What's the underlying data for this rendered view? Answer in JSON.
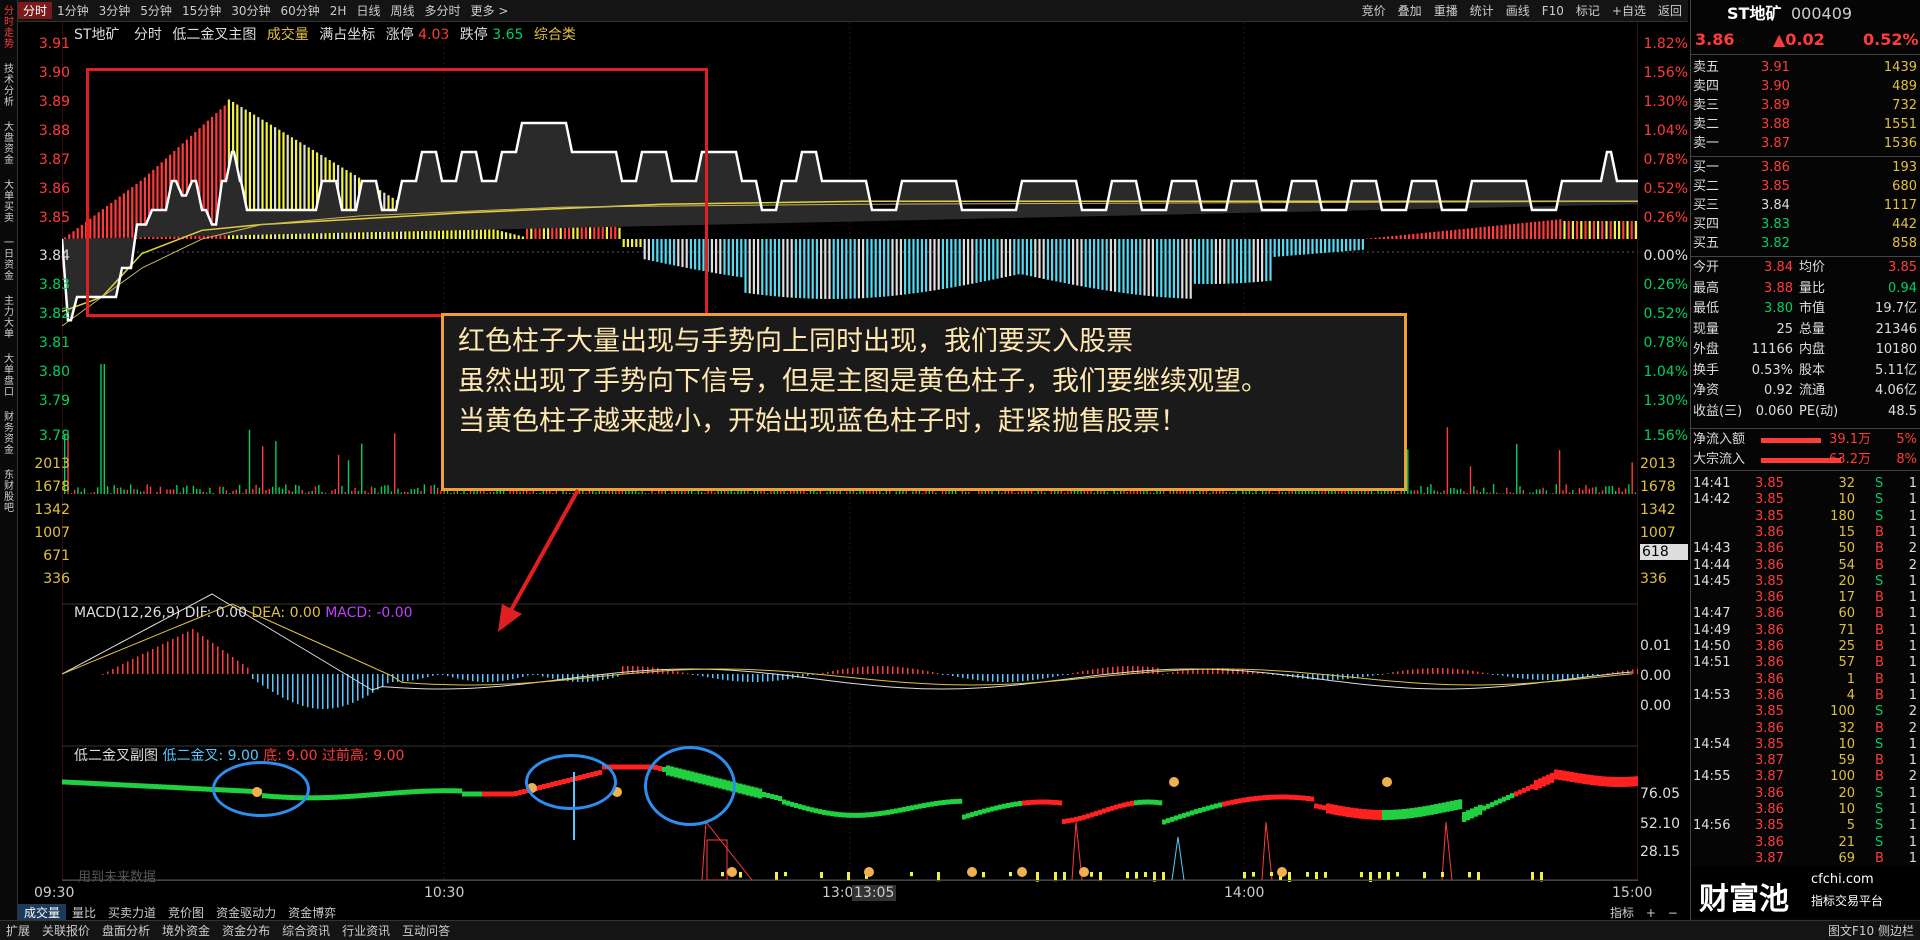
{
  "left_tabs": [
    "分时走势",
    "技术分析",
    "大盘资金",
    "大单买卖",
    "一日资金",
    "主力大单",
    "大单盘口",
    "财务资金",
    "东财股吧"
  ],
  "periods": [
    "分时",
    "1分钟",
    "3分钟",
    "5分钟",
    "15分钟",
    "30分钟",
    "60分钟",
    "2H",
    "日线",
    "周线",
    "多分时",
    "更多 >"
  ],
  "toolbar": [
    "竞价",
    "叠加",
    "重播",
    "统计",
    "画线",
    "F10",
    "标记",
    "+自选",
    "返回"
  ],
  "chart_header": {
    "name": "ST地矿",
    "mode": "分时",
    "indicator": "低二金叉主图",
    "vol_label": "成交量",
    "coord": "满占坐标",
    "up_limit_label": "涨停",
    "up_limit": "4.03",
    "down_limit_label": "跌停",
    "down_limit": "3.65",
    "cat": "综合类"
  },
  "price_axis": [
    "3.91",
    "3.90",
    "3.89",
    "3.88",
    "3.87",
    "3.86",
    "3.85",
    "3.84",
    "3.83",
    "3.82",
    "3.81",
    "3.80",
    "3.79",
    "3.78"
  ],
  "pct_axis": [
    "1.82%",
    "1.56%",
    "1.30%",
    "1.04%",
    "0.78%",
    "0.52%",
    "0.26%",
    "0.00%",
    "0.26%",
    "0.52%",
    "0.78%",
    "1.04%",
    "1.30%",
    "1.56%"
  ],
  "vol_axis": [
    "2013",
    "1678",
    "1342",
    "1007",
    "671",
    "336"
  ],
  "vol_current": "618",
  "macd": {
    "title": "MACD(12,26,9)",
    "dif": "DIF: 0.00",
    "dea": "DEA: 0.00",
    "macd": "MACD: -0.00",
    "axis": [
      "0.01",
      "0.00",
      "0.00"
    ]
  },
  "sub": {
    "title": "低二金叉副图",
    "l1": "低二金叉: 9.00",
    "l2": "底: 9.00",
    "l3": "过前高: 9.00",
    "axis": [
      "76.05",
      "52.10",
      "28.15"
    ],
    "note": "用到未来数据"
  },
  "time_axis": [
    "09:30",
    "10:30",
    "13:00",
    "13:05",
    "14:00",
    "15:00"
  ],
  "time_right": "指标",
  "annotation": {
    "line1": "红色柱子大量出现与手势向上同时出现，我们要买入股票",
    "line2": "虽然出现了手势向下信号，但是主图是黄色柱子，我们要继续观望。",
    "line3": "当黄色柱子越来越小，开始出现蓝色柱子时，赶紧抛售股票！"
  },
  "quote": {
    "name": "ST地矿",
    "code": "000409",
    "price": "3.86",
    "change": "▲0.02",
    "pct": "0.52%",
    "asks": [
      [
        "卖五",
        "3.91",
        "1439"
      ],
      [
        "卖四",
        "3.90",
        "489"
      ],
      [
        "卖三",
        "3.89",
        "732"
      ],
      [
        "卖二",
        "3.88",
        "1551"
      ],
      [
        "卖一",
        "3.87",
        "1536"
      ]
    ],
    "bids": [
      [
        "买一",
        "3.86",
        "193"
      ],
      [
        "买二",
        "3.85",
        "680"
      ],
      [
        "买三",
        "3.84",
        "1117"
      ],
      [
        "买四",
        "3.83",
        "442"
      ],
      [
        "买五",
        "3.82",
        "858"
      ]
    ],
    "stats": [
      [
        "今开",
        "3.84",
        "均价",
        "3.85"
      ],
      [
        "最高",
        "3.88",
        "量比",
        "0.94"
      ],
      [
        "最低",
        "3.80",
        "市值",
        "19.7亿"
      ],
      [
        "现量",
        "25",
        "总量",
        "21346"
      ],
      [
        "外盘",
        "11166",
        "内盘",
        "10180"
      ],
      [
        "换手",
        "0.53%",
        "股本",
        "5.11亿"
      ],
      [
        "净资",
        "0.92",
        "流通",
        "4.06亿"
      ],
      [
        "收益(三)",
        "0.060",
        "PE(动)",
        "48.5"
      ]
    ],
    "flows": [
      [
        "净流入额",
        "39.1万",
        "5%"
      ],
      [
        "大宗流入",
        "63.2万",
        "8%"
      ]
    ],
    "ticks": [
      [
        "14:41",
        "3.85",
        "32",
        "S",
        "1"
      ],
      [
        "14:42",
        "3.85",
        "10",
        "S",
        "1"
      ],
      [
        "",
        "3.85",
        "180",
        "S",
        "1"
      ],
      [
        "",
        "3.86",
        "15",
        "B",
        "1"
      ],
      [
        "14:43",
        "3.86",
        "50",
        "B",
        "2"
      ],
      [
        "14:44",
        "3.86",
        "54",
        "B",
        "2"
      ],
      [
        "14:45",
        "3.85",
        "20",
        "S",
        "1"
      ],
      [
        "",
        "3.86",
        "17",
        "B",
        "1"
      ],
      [
        "14:47",
        "3.86",
        "60",
        "B",
        "1"
      ],
      [
        "14:49",
        "3.86",
        "71",
        "B",
        "1"
      ],
      [
        "14:50",
        "3.86",
        "25",
        "B",
        "1"
      ],
      [
        "14:51",
        "3.86",
        "57",
        "B",
        "1"
      ],
      [
        "",
        "3.86",
        "1",
        "B",
        "1"
      ],
      [
        "14:53",
        "3.86",
        "4",
        "B",
        "1"
      ],
      [
        "",
        "3.85",
        "100",
        "S",
        "2"
      ],
      [
        "",
        "3.86",
        "32",
        "B",
        "2"
      ],
      [
        "14:54",
        "3.85",
        "10",
        "S",
        "1"
      ],
      [
        "",
        "3.87",
        "59",
        "B",
        "1"
      ],
      [
        "14:55",
        "3.87",
        "100",
        "B",
        "2"
      ],
      [
        "",
        "3.86",
        "20",
        "S",
        "1"
      ],
      [
        "",
        "3.86",
        "10",
        "S",
        "1"
      ],
      [
        "14:56",
        "3.85",
        "5",
        "S",
        "1"
      ],
      [
        "",
        "3.86",
        "21",
        "S",
        "1"
      ],
      [
        "",
        "3.87",
        "69",
        "B",
        "1"
      ]
    ]
  },
  "watermark": {
    "site": "cfchi.com",
    "brand": "财富池",
    "slogan": "指标交易平台"
  },
  "bottom_tabs": [
    "扩展",
    "关联报价",
    "盘面分析",
    "境外资金",
    "资金分布",
    "综合资讯",
    "行业资讯",
    "互动问答"
  ],
  "bottom_bar2": [
    "成交量",
    "量比",
    "买卖力道",
    "竞价图",
    "资金驱动力",
    "资金博弈"
  ],
  "bottom_right": "图文F10 侧边栏",
  "colors": {
    "up": "#ff3b3b",
    "down": "#00d060",
    "accent": "#e02020",
    "annotation_border": "#f0a030",
    "circle": "#2d8ef0"
  }
}
